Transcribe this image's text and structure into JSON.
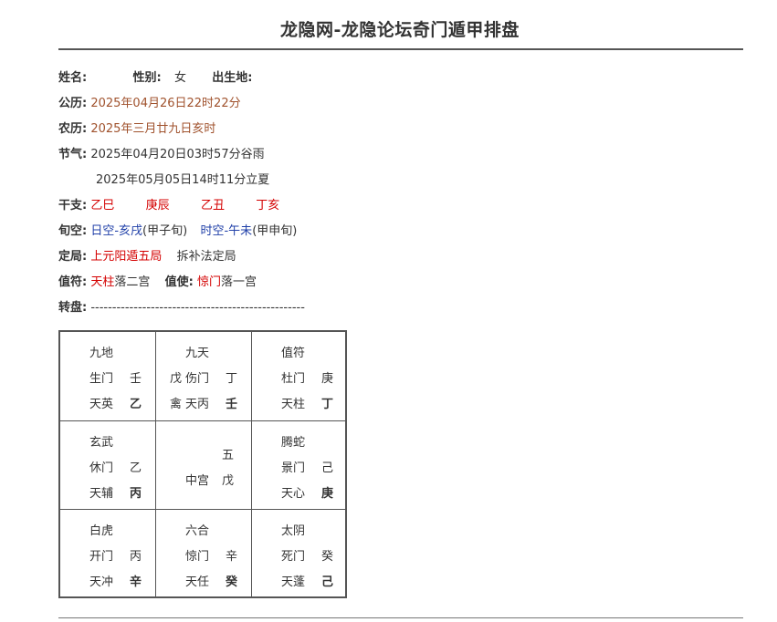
{
  "title": "龙隐网-龙隐论坛奇门遁甲排盘",
  "info": {
    "name_label": "姓名:",
    "gender_label": "性别:",
    "gender_value": "女",
    "birthplace_label": "出生地:",
    "solar_label": "公历:",
    "solar_value": "2025年04月26日22时22分",
    "lunar_label": "农历:",
    "lunar_value": "2025年三月廿九日亥时",
    "jieqi_label": "节气:",
    "jieqi_1": "2025年04月20日03时57分谷雨",
    "jieqi_2": "2025年05月05日14时11分立夏",
    "ganzhi_label": "干支:",
    "ganzhi": [
      "乙巳",
      "庚辰",
      "乙丑",
      "丁亥"
    ],
    "xunkong_label": "旬空:",
    "rikong": "日空-亥戌",
    "rikong_xun": "(甲子旬)",
    "shikong": "时空-午未",
    "shikong_xun": "(甲申旬)",
    "dingju_label": "定局:",
    "dingju_value": "上元阳遁五局",
    "dingju_method": "拆补法定局",
    "zhifu_label": "值符:",
    "zhifu_star": "天柱",
    "zhifu_palace": "落二宫",
    "zhishi_label": "值使:",
    "zhishi_door": "惊门",
    "zhishi_palace": "落一宫",
    "zhuanpan_label": "转盘:",
    "zhuanpan_line": "--------------------------------------------------"
  },
  "palaces": {
    "p1": {
      "god": "九地",
      "door": "生门",
      "door_stem": "壬",
      "star": "天英",
      "star_stem": "乙"
    },
    "p2": {
      "god": "九天",
      "extra_stem": "戊",
      "door": "伤门",
      "door_stem": "丁",
      "extra_star": "禽",
      "star": "天丙",
      "star_stem": "壬"
    },
    "p3": {
      "god": "值符",
      "door": "杜门",
      "door_stem": "庚",
      "star": "天柱",
      "star_stem": "丁"
    },
    "p4": {
      "god": "玄武",
      "door": "休门",
      "door_stem": "乙",
      "star": "天辅",
      "star_stem": "丙"
    },
    "p5": {
      "number": "五",
      "label": "中宫",
      "stem": "戊"
    },
    "p6": {
      "god": "腾蛇",
      "door": "景门",
      "door_stem": "己",
      "star": "天心",
      "star_stem": "庚"
    },
    "p7": {
      "god": "白虎",
      "door": "开门",
      "door_stem": "丙",
      "star": "天冲",
      "star_stem": "辛"
    },
    "p8": {
      "god": "六合",
      "door": "惊门",
      "door_stem": "辛",
      "star": "天任",
      "star_stem": "癸"
    },
    "p9": {
      "god": "太阴",
      "door": "死门",
      "door_stem": "癸",
      "star": "天蓬",
      "star_stem": "己"
    }
  },
  "colors": {
    "brown": "#a0522d",
    "red": "#d40000",
    "blue": "#1f3fa8"
  }
}
